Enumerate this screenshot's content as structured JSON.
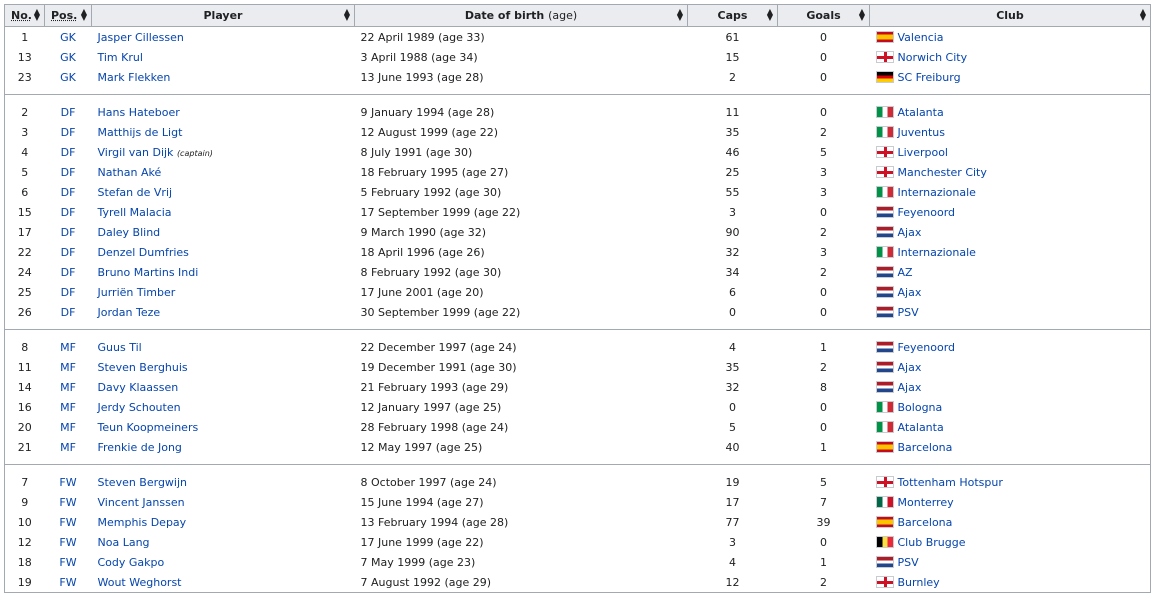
{
  "columns": {
    "no": "No.",
    "pos": "Pos.",
    "player": "Player",
    "dob": "Date of birth",
    "dob_suffix": "(age)",
    "caps": "Caps",
    "goals": "Goals",
    "club": "Club"
  },
  "captain_label": "(captain)",
  "groups": [
    [
      {
        "no": "1",
        "pos": "GK",
        "player": "Jasper Cillessen",
        "dob": "22 April 1989 (age 33)",
        "caps": "61",
        "goals": "0",
        "club": "Valencia",
        "flag": "es"
      },
      {
        "no": "13",
        "pos": "GK",
        "player": "Tim Krul",
        "dob": "3 April 1988 (age 34)",
        "caps": "15",
        "goals": "0",
        "club": "Norwich City",
        "flag": "en"
      },
      {
        "no": "23",
        "pos": "GK",
        "player": "Mark Flekken",
        "dob": "13 June 1993 (age 28)",
        "caps": "2",
        "goals": "0",
        "club": "SC Freiburg",
        "flag": "de"
      }
    ],
    [
      {
        "no": "2",
        "pos": "DF",
        "player": "Hans Hateboer",
        "dob": "9 January 1994 (age 28)",
        "caps": "11",
        "goals": "0",
        "club": "Atalanta",
        "flag": "it"
      },
      {
        "no": "3",
        "pos": "DF",
        "player": "Matthijs de Ligt",
        "dob": "12 August 1999 (age 22)",
        "caps": "35",
        "goals": "2",
        "club": "Juventus",
        "flag": "it"
      },
      {
        "no": "4",
        "pos": "DF",
        "player": "Virgil van Dijk",
        "captain": true,
        "dob": "8 July 1991 (age 30)",
        "caps": "46",
        "goals": "5",
        "club": "Liverpool",
        "flag": "en"
      },
      {
        "no": "5",
        "pos": "DF",
        "player": "Nathan Aké",
        "dob": "18 February 1995 (age 27)",
        "caps": "25",
        "goals": "3",
        "club": "Manchester City",
        "flag": "en"
      },
      {
        "no": "6",
        "pos": "DF",
        "player": "Stefan de Vrij",
        "dob": "5 February 1992 (age 30)",
        "caps": "55",
        "goals": "3",
        "club": "Internazionale",
        "flag": "it"
      },
      {
        "no": "15",
        "pos": "DF",
        "player": "Tyrell Malacia",
        "dob": "17 September 1999 (age 22)",
        "caps": "3",
        "goals": "0",
        "club": "Feyenoord",
        "flag": "nl"
      },
      {
        "no": "17",
        "pos": "DF",
        "player": "Daley Blind",
        "dob": "9 March 1990 (age 32)",
        "caps": "90",
        "goals": "2",
        "club": "Ajax",
        "flag": "nl"
      },
      {
        "no": "22",
        "pos": "DF",
        "player": "Denzel Dumfries",
        "dob": "18 April 1996 (age 26)",
        "caps": "32",
        "goals": "3",
        "club": "Internazionale",
        "flag": "it"
      },
      {
        "no": "24",
        "pos": "DF",
        "player": "Bruno Martins Indi",
        "dob": "8 February 1992 (age 30)",
        "caps": "34",
        "goals": "2",
        "club": "AZ",
        "flag": "nl"
      },
      {
        "no": "25",
        "pos": "DF",
        "player": "Jurriën Timber",
        "dob": "17 June 2001 (age 20)",
        "caps": "6",
        "goals": "0",
        "club": "Ajax",
        "flag": "nl"
      },
      {
        "no": "26",
        "pos": "DF",
        "player": "Jordan Teze",
        "dob": "30 September 1999 (age 22)",
        "caps": "0",
        "goals": "0",
        "club": "PSV",
        "flag": "nl"
      }
    ],
    [
      {
        "no": "8",
        "pos": "MF",
        "player": "Guus Til",
        "dob": "22 December 1997 (age 24)",
        "caps": "4",
        "goals": "1",
        "club": "Feyenoord",
        "flag": "nl"
      },
      {
        "no": "11",
        "pos": "MF",
        "player": "Steven Berghuis",
        "dob": "19 December 1991 (age 30)",
        "caps": "35",
        "goals": "2",
        "club": "Ajax",
        "flag": "nl"
      },
      {
        "no": "14",
        "pos": "MF",
        "player": "Davy Klaassen",
        "dob": "21 February 1993 (age 29)",
        "caps": "32",
        "goals": "8",
        "club": "Ajax",
        "flag": "nl"
      },
      {
        "no": "16",
        "pos": "MF",
        "player": "Jerdy Schouten",
        "dob": "12 January 1997 (age 25)",
        "caps": "0",
        "goals": "0",
        "club": "Bologna",
        "flag": "it"
      },
      {
        "no": "20",
        "pos": "MF",
        "player": "Teun Koopmeiners",
        "dob": "28 February 1998 (age 24)",
        "caps": "5",
        "goals": "0",
        "club": "Atalanta",
        "flag": "it"
      },
      {
        "no": "21",
        "pos": "MF",
        "player": "Frenkie de Jong",
        "dob": "12 May 1997 (age 25)",
        "caps": "40",
        "goals": "1",
        "club": "Barcelona",
        "flag": "es"
      }
    ],
    [
      {
        "no": "7",
        "pos": "FW",
        "player": "Steven Bergwijn",
        "dob": "8 October 1997 (age 24)",
        "caps": "19",
        "goals": "5",
        "club": "Tottenham Hotspur",
        "flag": "en"
      },
      {
        "no": "9",
        "pos": "FW",
        "player": "Vincent Janssen",
        "dob": "15 June 1994 (age 27)",
        "caps": "17",
        "goals": "7",
        "club": "Monterrey",
        "flag": "mx"
      },
      {
        "no": "10",
        "pos": "FW",
        "player": "Memphis Depay",
        "dob": "13 February 1994 (age 28)",
        "caps": "77",
        "goals": "39",
        "club": "Barcelona",
        "flag": "es"
      },
      {
        "no": "12",
        "pos": "FW",
        "player": "Noa Lang",
        "dob": "17 June 1999 (age 22)",
        "caps": "3",
        "goals": "0",
        "club": "Club Brugge",
        "flag": "be"
      },
      {
        "no": "18",
        "pos": "FW",
        "player": "Cody Gakpo",
        "dob": "7 May 1999 (age 23)",
        "caps": "4",
        "goals": "1",
        "club": "PSV",
        "flag": "nl"
      },
      {
        "no": "19",
        "pos": "FW",
        "player": "Wout Weghorst",
        "dob": "7 August 1992 (age 29)",
        "caps": "12",
        "goals": "2",
        "club": "Burnley",
        "flag": "en"
      }
    ]
  ]
}
